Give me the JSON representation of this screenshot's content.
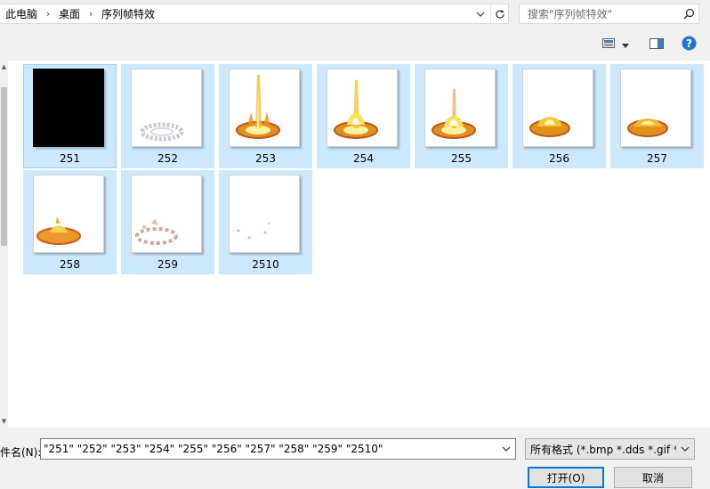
{
  "breadcrumb": [
    {
      "label": "此电脑"
    },
    {
      "label": "桌面"
    },
    {
      "label": "序列帧特效"
    }
  ],
  "search": {
    "placeholder": "搜索\"序列帧特效\""
  },
  "files": [
    {
      "name": "251",
      "thumb": "black"
    },
    {
      "name": "252",
      "thumb": "ring"
    },
    {
      "name": "253",
      "thumb": "pillar-tall"
    },
    {
      "name": "254",
      "thumb": "pillar-mid"
    },
    {
      "name": "255",
      "thumb": "pillar-short"
    },
    {
      "name": "256",
      "thumb": "flare"
    },
    {
      "name": "257",
      "thumb": "flare-small"
    },
    {
      "name": "258",
      "thumb": "burst"
    },
    {
      "name": "259",
      "thumb": "fade"
    },
    {
      "name": "2510",
      "thumb": "sparks"
    }
  ],
  "bottom": {
    "filename_label": "件名(N):",
    "filename_value": "\"251\" \"252\" \"253\" \"254\" \"255\" \"256\" \"257\" \"258\" \"259\" \"2510\"",
    "filter_value": "所有格式 (*.bmp *.dds *.gif *",
    "open_label": "打开(O)",
    "cancel_label": "取消"
  },
  "icons": {
    "accent": "#1e77d3",
    "selection": "#cce8ff",
    "help": "?"
  }
}
